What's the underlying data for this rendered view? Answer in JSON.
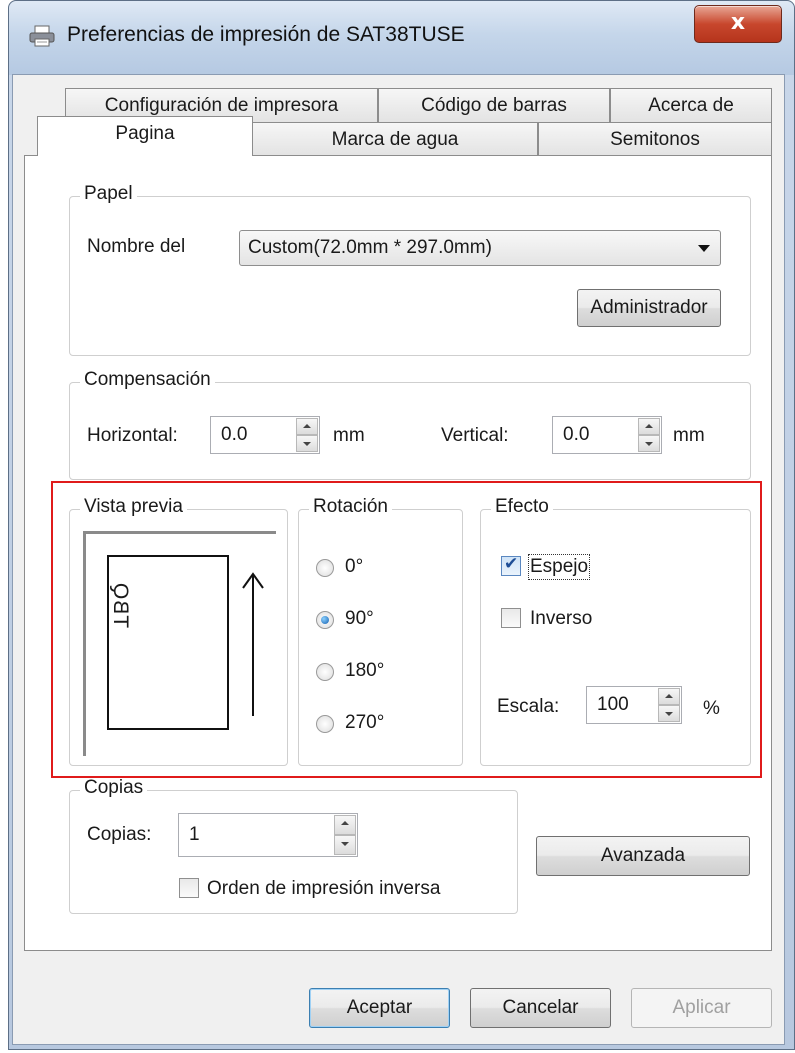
{
  "window": {
    "title": "Preferencias de impresión de SAT38TUSE",
    "close_label": "x"
  },
  "tabs": {
    "row1": [
      "Configuración de impresora",
      "Código de barras",
      "Acerca de"
    ],
    "row2": [
      "Pagina",
      "Marca de agua",
      "Semitonos"
    ],
    "active": "Pagina"
  },
  "papel": {
    "group_label": "Papel",
    "name_label": "Nombre del",
    "paper_value": "Custom(72.0mm * 297.0mm)",
    "admin_button": "Administrador"
  },
  "compensacion": {
    "group_label": "Compensación",
    "horizontal_label": "Horizontal:",
    "horizontal_value": "0.0",
    "horizontal_unit": "mm",
    "vertical_label": "Vertical:",
    "vertical_value": "0.0",
    "vertical_unit": "mm"
  },
  "vista_previa": {
    "group_label": "Vista previa",
    "preview_text": "TBQ"
  },
  "rotacion": {
    "group_label": "Rotación",
    "options": [
      "0°",
      "90°",
      "180°",
      "270°"
    ],
    "selected": "90°"
  },
  "efecto": {
    "group_label": "Efecto",
    "espejo_label": "Espejo",
    "espejo_checked": true,
    "inverso_label": "Inverso",
    "inverso_checked": false,
    "escala_label": "Escala:",
    "escala_value": "100",
    "escala_unit": "%"
  },
  "copias": {
    "group_label": "Copias",
    "copias_label": "Copias:",
    "copias_value": "1",
    "orden_label": "Orden de impresión inversa",
    "orden_checked": false,
    "avanzada_button": "Avanzada"
  },
  "footer": {
    "aceptar": "Aceptar",
    "cancelar": "Cancelar",
    "aplicar": "Aplicar"
  },
  "colors": {
    "highlight": "#e01b1b",
    "close_button": "#c8472d"
  }
}
